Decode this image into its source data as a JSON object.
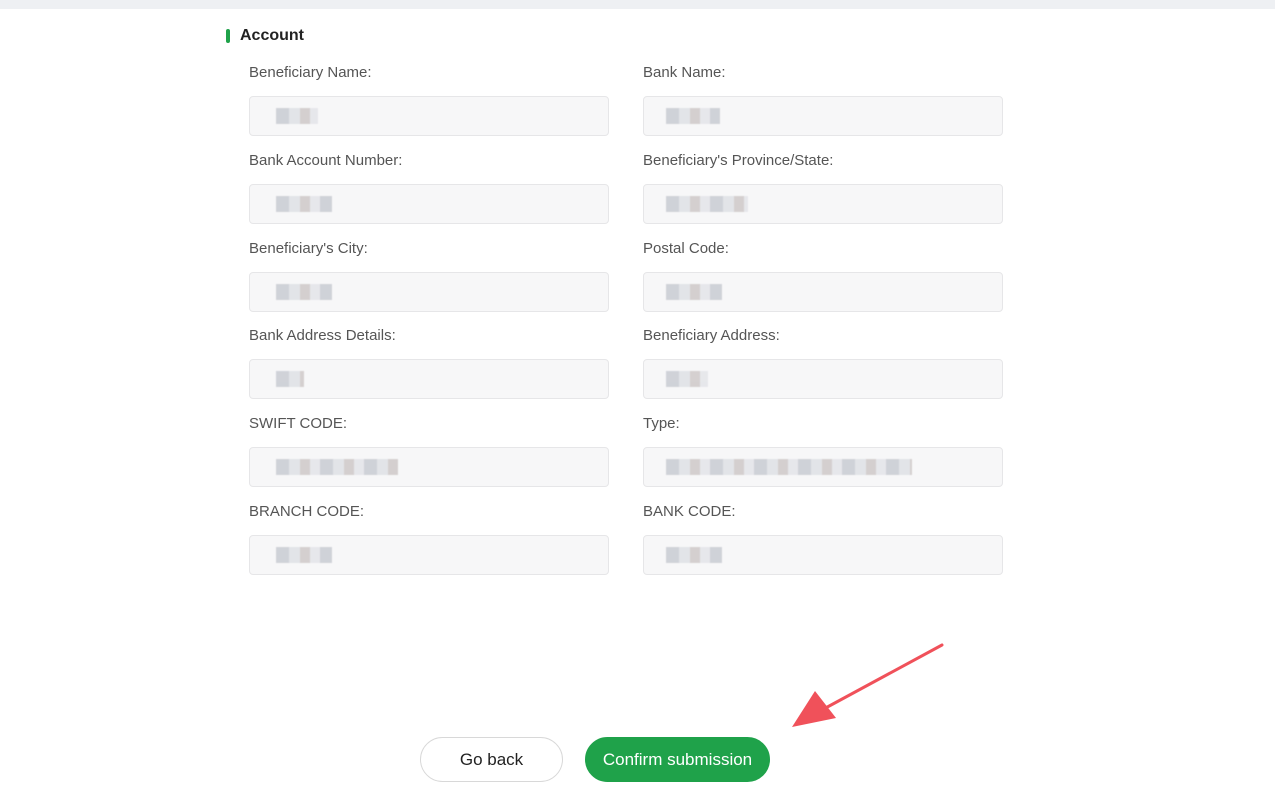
{
  "section": {
    "title": "Account"
  },
  "fields": [
    {
      "label": "Beneficiary Name:",
      "value": "███"
    },
    {
      "label": "Bank Name:",
      "value": "████"
    },
    {
      "label": "Bank Account Number:",
      "value": "████"
    },
    {
      "label": "Beneficiary's Province/State:",
      "value": "██████"
    },
    {
      "label": "Beneficiary's City:",
      "value": "████"
    },
    {
      "label": "Postal Code:",
      "value": "████"
    },
    {
      "label": "Bank Address Details:",
      "value": "██"
    },
    {
      "label": "Beneficiary Address:",
      "value": "███"
    },
    {
      "label": "SWIFT CODE:",
      "value": "█████████"
    },
    {
      "label": "Type:",
      "value": "██████████████████"
    },
    {
      "label": "BRANCH CODE:",
      "value": "████"
    },
    {
      "label": "BANK CODE:",
      "value": "████"
    }
  ],
  "actions": {
    "back_label": "Go back",
    "confirm_label": "Confirm submission"
  },
  "colors": {
    "accent": "#1fa24a",
    "annotation_arrow": "#f0515a",
    "input_bg": "#f7f7f8"
  },
  "annotation": {
    "icon": "red-arrow-icon",
    "points_to": "confirm-submission-button"
  }
}
